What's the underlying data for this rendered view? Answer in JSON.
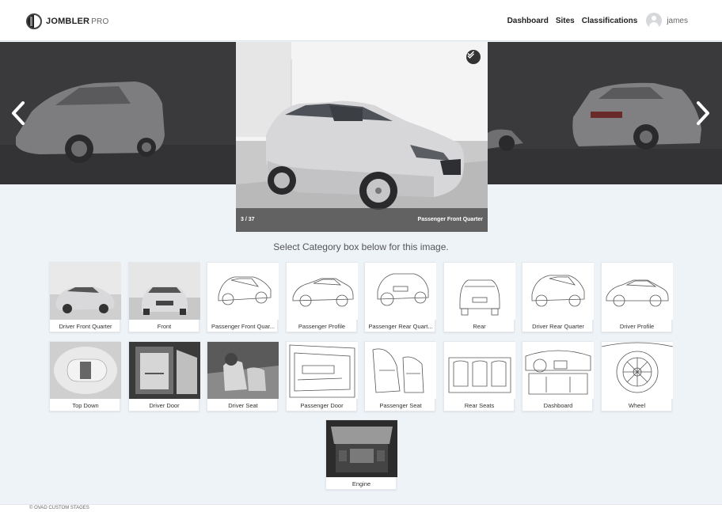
{
  "header": {
    "logo_text": "JOMBLER",
    "logo_suffix": "PRO",
    "nav": [
      "Dashboard",
      "Sites",
      "Classifications"
    ],
    "username": "james"
  },
  "carousel": {
    "counter": "3 / 37",
    "current_label": "Passenger Front Quarter",
    "prev_icon": "chevron-left-icon",
    "next_icon": "chevron-right-icon",
    "approve_icon": "double-check-icon"
  },
  "instruction": "Select Category box below for this image.",
  "categories": [
    {
      "label": "Driver Front Quarter",
      "kind": "photo"
    },
    {
      "label": "Front",
      "kind": "photo"
    },
    {
      "label": "Passenger Front Quar...",
      "kind": "sketch"
    },
    {
      "label": "Passenger Profile",
      "kind": "sketch"
    },
    {
      "label": "Passenger Rear Quart...",
      "kind": "sketch"
    },
    {
      "label": "Rear",
      "kind": "sketch"
    },
    {
      "label": "Driver Rear Quarter",
      "kind": "sketch"
    },
    {
      "label": "Driver Profile",
      "kind": "sketch"
    },
    {
      "label": "Top Down",
      "kind": "photo"
    },
    {
      "label": "Driver Door",
      "kind": "photo"
    },
    {
      "label": "Driver Seat",
      "kind": "photo"
    },
    {
      "label": "Passenger Door",
      "kind": "sketch"
    },
    {
      "label": "Passenger Seat",
      "kind": "sketch"
    },
    {
      "label": "Rear Seats",
      "kind": "sketch"
    },
    {
      "label": "Dashboard",
      "kind": "sketch"
    },
    {
      "label": "Wheel",
      "kind": "sketch"
    },
    {
      "label": "Engine",
      "kind": "photo"
    }
  ],
  "footer": {
    "copyright": "© OVAD CUSTOM STAGES"
  },
  "colors": {
    "page_bg": "#eef3f8",
    "carousel_bg": "#2b2b2d",
    "header_bg": "#ffffff"
  }
}
